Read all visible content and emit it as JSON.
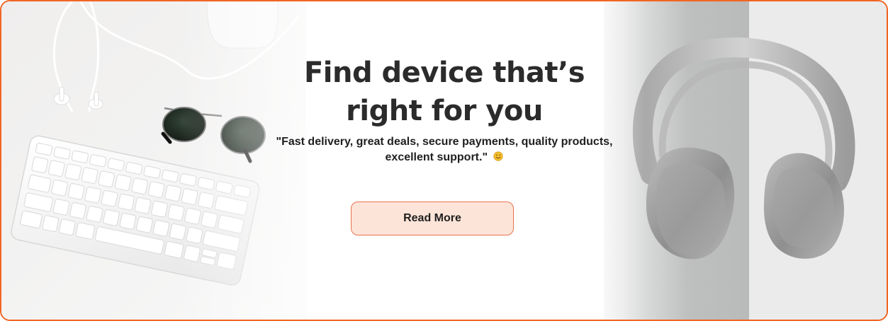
{
  "banner": {
    "title_line_1": "Find device that’s",
    "title_line_2": "right for you",
    "tagline_line_1": "\"Fast delivery, great deals, secure payments, quality products,",
    "tagline_line_2": "excellent support.\"",
    "emoji_icon": "smiling-face-icon",
    "button_label": "Read More"
  },
  "colors": {
    "border": "#f26522",
    "button_fill": "#fde4d8",
    "button_border": "#e8744f",
    "title_text": "#2b2b2b"
  },
  "images": {
    "left": "desk-accessories-keyboard-sunglasses-earphones",
    "right": "gray-headphones"
  }
}
